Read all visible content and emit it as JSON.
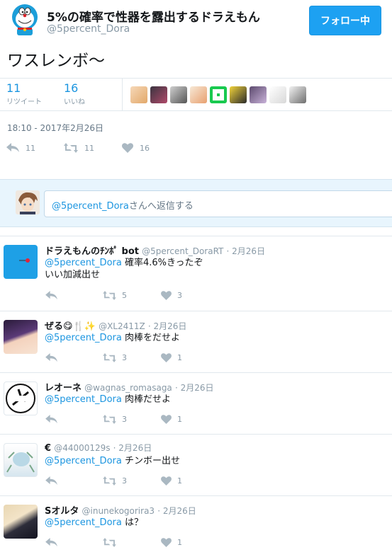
{
  "header": {
    "author_name": "5%の確率で性器を露出するドラえもん",
    "author_handle": "@5percent_Dora",
    "follow_label": "フォロー中"
  },
  "tweet": {
    "text": "ワスレンボ〜",
    "retweets_count": "11",
    "retweets_label": "リツイート",
    "likes_count": "16",
    "likes_label": "いいね",
    "timestamp": "18:10 - 2017年2月26日",
    "actions": {
      "reply_count": "11",
      "retweet_count": "11",
      "like_count": "16"
    }
  },
  "reply_box": {
    "mention": "@5percent_Dora",
    "placeholder_suffix": "さんへ返信する"
  },
  "colors": {
    "accent": "#1da1f2",
    "link": "#1b95e0",
    "muted": "#8899a6"
  },
  "replies": [
    {
      "name": "ドラえもんのﾁﾝﾎﾟ bot",
      "handle": "@5percent_DoraRT",
      "date": "· 2月26日",
      "mention": "@5percent_Dora",
      "text": "確率4.6%きったぞ",
      "text2": "いい加減出せ",
      "retweets": "5",
      "likes": "3"
    },
    {
      "name": "ぜる😋🍴✨",
      "handle": "@XL2411Z",
      "date": "· 2月26日",
      "mention": "@5percent_Dora",
      "text": "肉棒をだせよ",
      "retweets": "3",
      "likes": "1"
    },
    {
      "name": "レオーネ",
      "handle": "@wagnas_romasaga",
      "date": "· 2月26日",
      "mention": "@5percent_Dora",
      "text": "肉棒だせよ",
      "retweets": "3",
      "likes": "1"
    },
    {
      "name": "€",
      "handle": "@44000129s",
      "date": "· 2月26日",
      "mention": "@5percent_Dora",
      "text": "チンボー出せ",
      "retweets": "3",
      "likes": "1"
    },
    {
      "name": "Sオルタ",
      "handle": "@inunekogorira3",
      "date": "· 2月26日",
      "mention": "@5percent_Dora",
      "text": "は？",
      "retweets": "",
      "likes": "1"
    }
  ]
}
